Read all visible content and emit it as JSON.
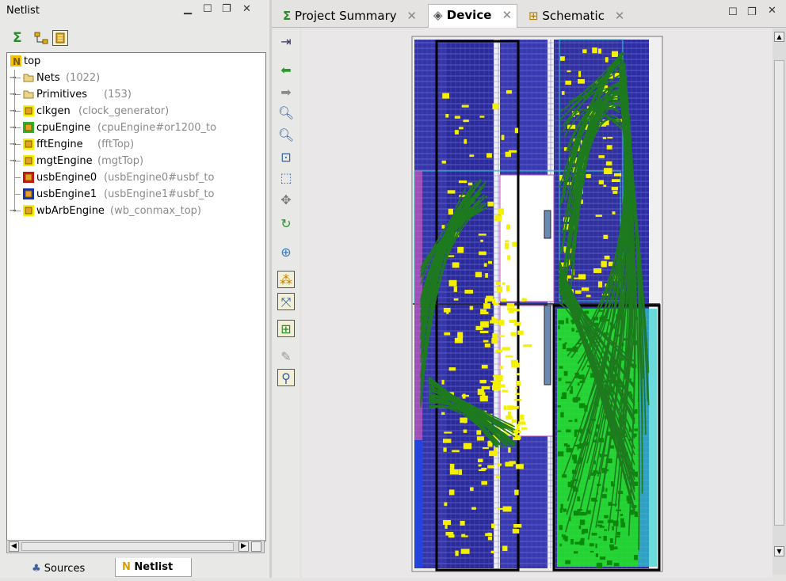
{
  "left_panel": {
    "title": "Netlist",
    "window_controls": [
      "minimize-icon",
      "maximize-icon",
      "restore-icon",
      "close-icon"
    ],
    "toolbar": [
      "sigma-icon",
      "hierarchy-icon",
      "netlist-view-icon"
    ],
    "tree": {
      "root": "top",
      "items": [
        {
          "name": "Nets",
          "detail": "(1022)",
          "icon": "folder-icon",
          "expandable": true
        },
        {
          "name": "Primitives",
          "detail": "(153)",
          "icon": "folder-icon",
          "expandable": true
        },
        {
          "name": "clkgen",
          "detail": "(clock_generator)",
          "icon": "module-icon",
          "highlight": "#f5f000",
          "expandable": true
        },
        {
          "name": "cpuEngine",
          "detail": "(cpuEngine#or1200_to",
          "icon": "module-icon",
          "highlight": "#2ab52a",
          "expandable": true
        },
        {
          "name": "fftEngine",
          "detail": "(fftTop)",
          "icon": "module-icon",
          "highlight": "#f5f000",
          "expandable": true
        },
        {
          "name": "mgtEngine",
          "detail": "(mgtTop)",
          "icon": "module-icon",
          "highlight": "#f5f000",
          "expandable": true
        },
        {
          "name": "usbEngine0",
          "detail": "(usbEngine0#usbf_to",
          "icon": "module-icon",
          "highlight": "#d01010",
          "expandable": false
        },
        {
          "name": "usbEngine1",
          "detail": "(usbEngine1#usbf_to",
          "icon": "module-icon",
          "highlight": "#1030c0",
          "expandable": false
        },
        {
          "name": "wbArbEngine",
          "detail": "(wb_conmax_top)",
          "icon": "module-icon",
          "highlight": "#f5f000",
          "expandable": true
        }
      ]
    },
    "bottom_tabs": [
      {
        "label": "Sources",
        "icon": "sources-icon",
        "active": false
      },
      {
        "label": "Netlist",
        "icon": "netlist-icon",
        "active": true
      }
    ]
  },
  "editor": {
    "tabs": [
      {
        "label": "Project Summary",
        "icon": "sigma-icon",
        "active": false
      },
      {
        "label": "Device",
        "icon": "device-icon",
        "active": true
      },
      {
        "label": "Schematic",
        "icon": "schematic-icon",
        "active": false
      }
    ],
    "window_controls": [
      "maximize-icon",
      "restore-icon",
      "close-icon"
    ],
    "vertical_toolbar": [
      "fit-selection-icon",
      "back-arrow-icon",
      "forward-arrow-icon",
      "zoom-in-icon",
      "zoom-out-icon",
      "zoom-fit-icon",
      "select-area-icon",
      "pan-icon",
      "refresh-icon",
      "add-pblock-icon",
      "show-routing-icon",
      "move-icon",
      "place-icon",
      "unplace-icon",
      "search-icon"
    ]
  },
  "colors": {
    "selected_yellow": "#f5f000",
    "net_green": "#1e7a1e",
    "cell_lime": "#22ee22",
    "fabric_blue": "#3a3ab0"
  }
}
